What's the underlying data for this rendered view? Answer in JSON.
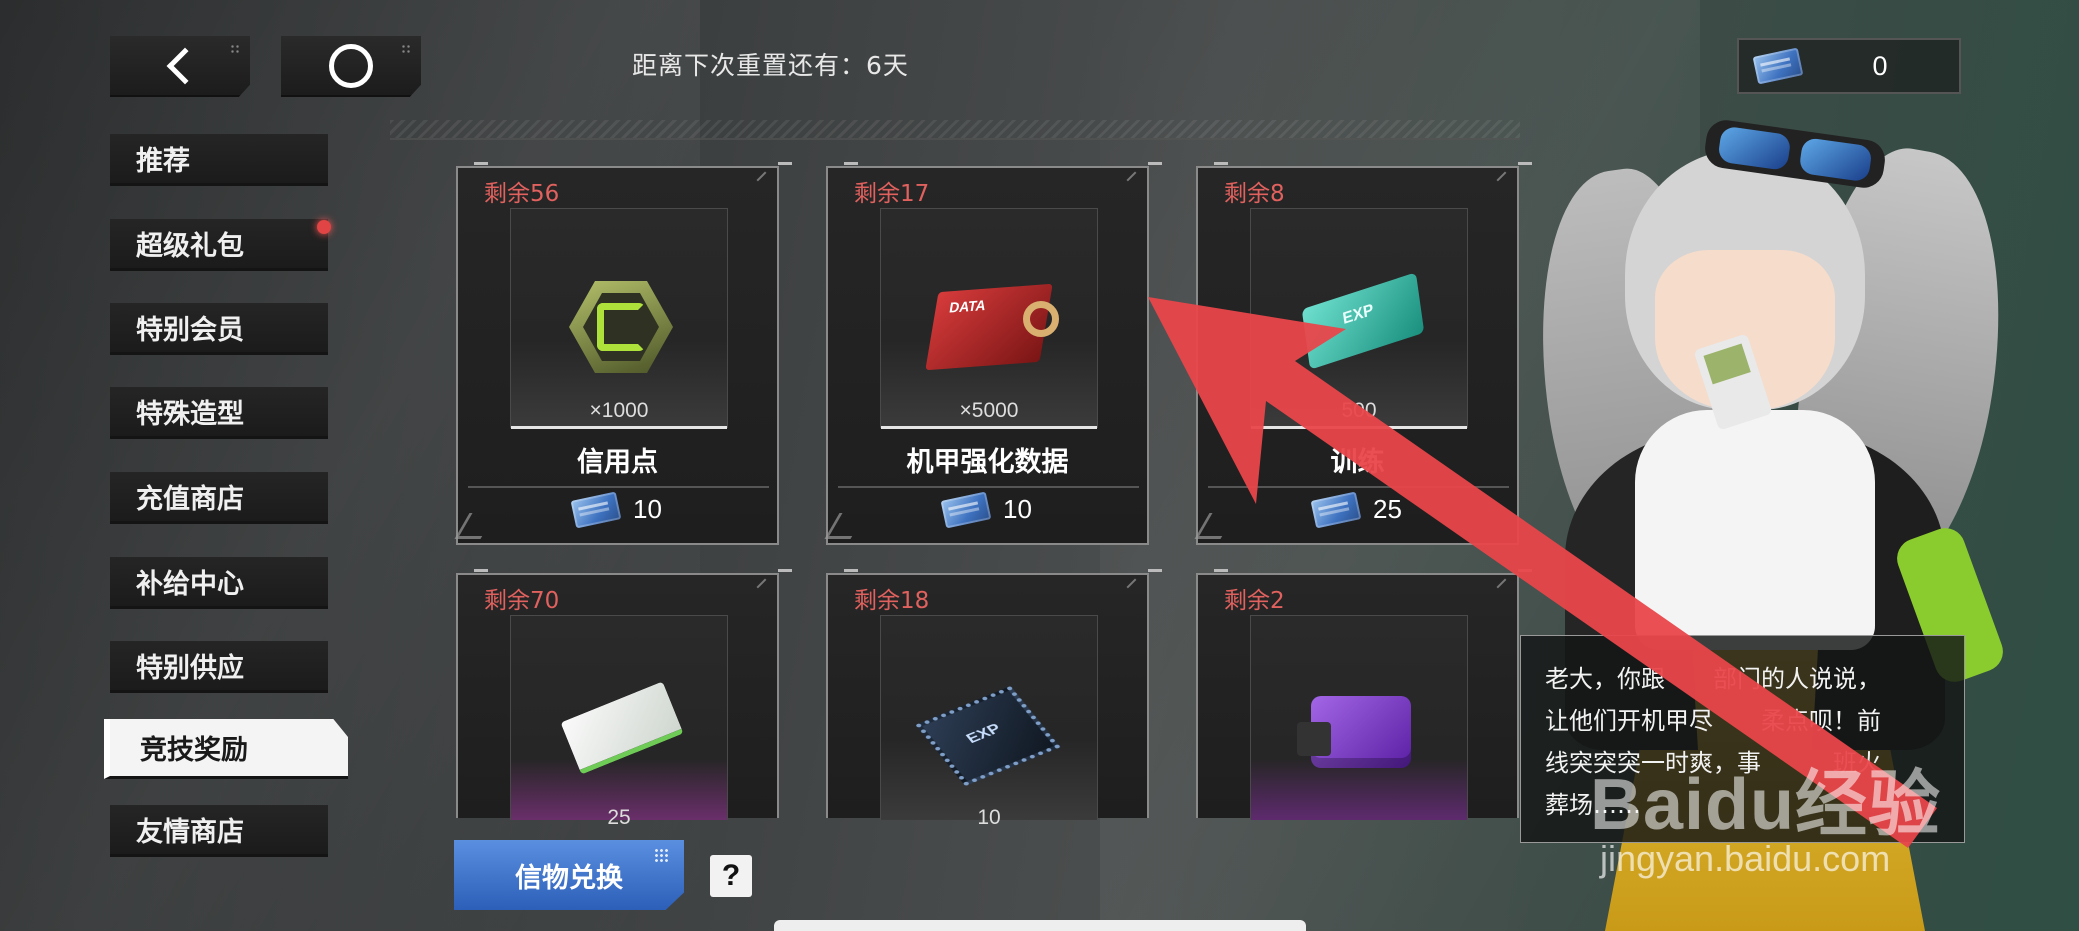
{
  "topbar": {
    "reset_text": "距离下次重置还有：6天",
    "currency_value": "0"
  },
  "sidebar": {
    "items": [
      {
        "label": "推荐"
      },
      {
        "label": "超级礼包"
      },
      {
        "label": "特别会员"
      },
      {
        "label": "特殊造型"
      },
      {
        "label": "充值商店"
      },
      {
        "label": "补给中心"
      },
      {
        "label": "特别供应"
      },
      {
        "label": "竞技奖励"
      },
      {
        "label": "友情商店"
      }
    ],
    "active_index": 7
  },
  "cards": [
    {
      "remain": "剩余56",
      "qty": "×1000",
      "name": "信用点",
      "price": "10",
      "icon": "credit-hex-icon"
    },
    {
      "remain": "剩余17",
      "qty": "×5000",
      "name": "机甲强化数据",
      "price": "10",
      "icon": "data-chip-icon"
    },
    {
      "remain": "剩余8",
      "qty": "500",
      "name": "训练",
      "price": "25",
      "icon": "exp-card-icon"
    },
    {
      "remain": "剩余70",
      "qty": "25",
      "name": "",
      "price": "",
      "icon": "paper-card-icon"
    },
    {
      "remain": "剩余18",
      "qty": "10",
      "name": "",
      "price": "",
      "icon": "exp-cpu-icon"
    },
    {
      "remain": "剩余2",
      "qty": "",
      "name": "",
      "price": "",
      "icon": "purple-box-icon"
    }
  ],
  "icon_labels": {
    "data_chip": "DATA",
    "exp_card": "EXP",
    "exp_cpu": "EXP"
  },
  "bottom": {
    "exchange_label": "信物兑换",
    "help_label": "?"
  },
  "dialogue": {
    "lines": [
      "老大，你跟",
      "部门的人说说，",
      "让他们开机甲尽",
      "柔点呗！前",
      "线突突突一时爽，事",
      "班火",
      "葬场……"
    ],
    "text": "老大，你跟　　部门的人说说，\n让他们开机甲尽　　柔点呗！前\n线突突突一时爽，事　　　班火\n葬场……"
  },
  "watermark": {
    "brand": "Baidu经验",
    "url": "jingyan.baidu.com"
  },
  "colors": {
    "remain_red": "#e0615e",
    "exchange_blue": "#3c72cc",
    "arrow_red": "#e8464a"
  }
}
